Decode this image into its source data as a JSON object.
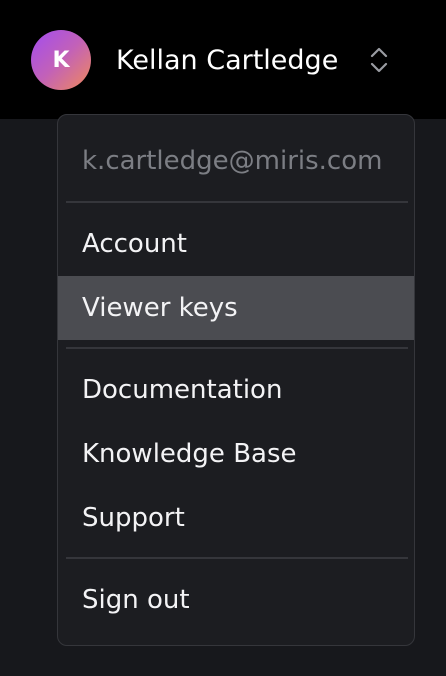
{
  "user": {
    "initial": "K",
    "name": "Kellan Cartledge",
    "email": "k.cartledge@miris.com"
  },
  "icons": {
    "switcher": "chevron-up-down-icon"
  },
  "menu": {
    "account": "Account",
    "viewer_keys": "Viewer keys",
    "documentation": "Documentation",
    "knowledge_base": "Knowledge Base",
    "support": "Support",
    "sign_out": "Sign out",
    "highlighted_item": "Viewer keys"
  },
  "colors": {
    "background": "#17181c",
    "topbar": "#000000",
    "menu_background": "#1c1d21",
    "highlight": "#4b4c51",
    "avatar_gradient": [
      "#a24cf0",
      "#f08a5a"
    ]
  }
}
